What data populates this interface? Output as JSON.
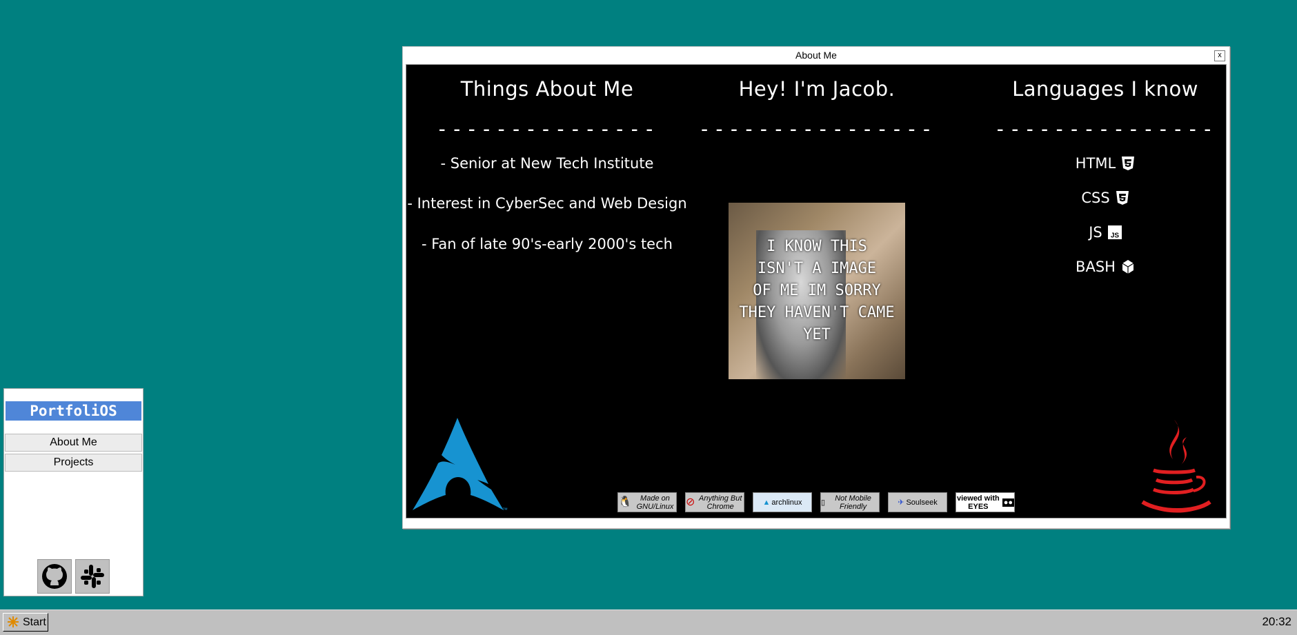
{
  "window": {
    "title": "About Me",
    "close_label": "x"
  },
  "about": {
    "heading": "Things About Me",
    "divider": "---------------",
    "items": [
      "- Senior at New Tech Institute",
      "- Interest in CyberSec and Web Design",
      "- Fan of late 90's-early 2000's tech"
    ]
  },
  "intro": {
    "heading": "Hey! I'm Jacob.",
    "divider": "----------------",
    "photo_caption": "I KNOW THIS\nISN'T A IMAGE\nOF ME IM SORRY\nTHEY HAVEN'T CAME\nYET"
  },
  "languages": {
    "heading": "Languages I know",
    "divider": "---------------",
    "items": [
      {
        "label": "HTML",
        "icon": "html5-icon"
      },
      {
        "label": "CSS",
        "icon": "css3-icon"
      },
      {
        "label": "JS",
        "icon": "javascript-icon"
      },
      {
        "label": "BASH",
        "icon": "bash-icon"
      }
    ]
  },
  "badges": [
    {
      "text": "Made on GNU/Linux",
      "icon": "tux-icon"
    },
    {
      "text": "Anything But Chrome",
      "icon": "no-chrome-icon"
    },
    {
      "text": "archlinux",
      "icon": "arch-icon"
    },
    {
      "text": "Not Mobile Friendly",
      "icon": "phone-icon"
    },
    {
      "text": "Soulseek",
      "icon": "bird-icon"
    },
    {
      "text": "viewed with EYES",
      "icon": "eyes-icon"
    }
  ],
  "sidebar": {
    "title": "PortfoliOS",
    "items": [
      "About Me",
      "Projects"
    ],
    "icons": [
      "github-icon",
      "slack-icon"
    ]
  },
  "taskbar": {
    "start_label": "Start",
    "clock": "20:32"
  },
  "colors": {
    "desktop": "#008080",
    "sidebar_title": "#4f86d8",
    "arch_blue": "#1793d1",
    "java_red": "#e11f21"
  }
}
